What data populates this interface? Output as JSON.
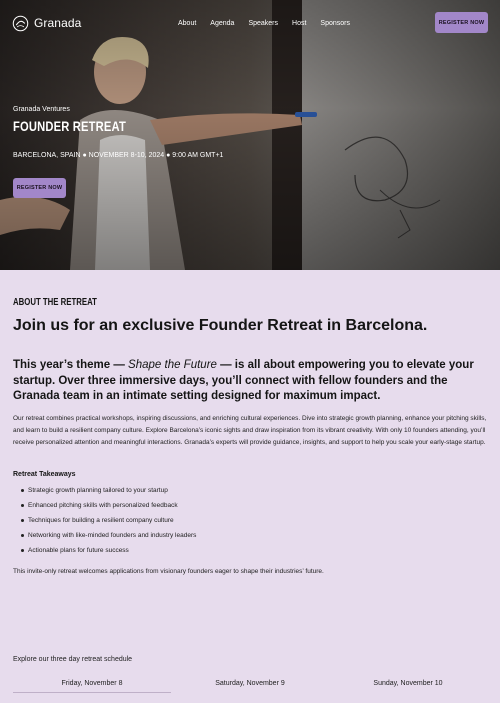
{
  "brand": {
    "name": "Granada",
    "accent": "#a287c9",
    "background": "#e7dced"
  },
  "nav": {
    "links": [
      "About",
      "Agenda",
      "Speakers",
      "Host",
      "Sponsors"
    ],
    "register_label": "REGISTER NOW"
  },
  "hero": {
    "eyebrow": "Granada Ventures",
    "title": "FOUNDER RETREAT",
    "meta": "BARCELONA, SPAIN ● NOVEMBER 8-10, 2024 ● 9:00 AM GMT+1",
    "cta_label": "REGISTER NOW"
  },
  "about": {
    "label": "ABOUT THE RETREAT",
    "headline": "Join us for an exclusive Founder Retreat in Barcelona.",
    "theme_before": "This year’s theme — ",
    "theme_emphasis": "Shape the Future",
    "theme_after": " — is all about empowering you to elevate your startup. Over three immersive days, you’ll connect with fellow founders and the Granada team in an intimate setting designed for maximum impact.",
    "body": "Our retreat combines practical workshops, inspiring discussions, and enriching cultural experiences. Dive into strategic growth planning, enhance your pitching skills, and learn to build a resilient company culture. Explore Barcelona’s iconic sights and draw inspiration from its vibrant creativity. With only 10 founders attending, you’ll receive personalized attention and meaningful interactions. Granada’s experts will provide guidance, insights, and support to help you scale your early-stage startup.",
    "takeaways_title": "Retreat Takeaways",
    "takeaways": [
      "Strategic growth planning tailored to your startup",
      "Enhanced pitching skills with personalized feedback",
      "Techniques for building a resilient company culture",
      "Networking with like-minded founders and industry leaders",
      "Actionable plans for future success"
    ],
    "closing": "This invite-only retreat welcomes applications from visionary founders eager to shape their industries’ future."
  },
  "schedule": {
    "label": "Explore our three day retreat schedule",
    "days": [
      "Friday, November 8",
      "Saturday, November 9",
      "Sunday, November 10"
    ]
  }
}
